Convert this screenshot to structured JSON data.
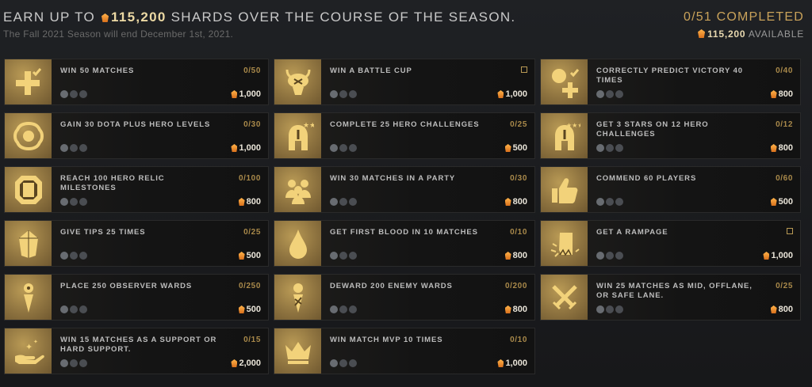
{
  "header": {
    "prefix": "EARN UP TO",
    "amount": "115,200",
    "suffix": "SHARDS OVER THE COURSE OF THE SEASON.",
    "sub": "The Fall 2021 Season will end December 1st, 2021.",
    "completed": "0/51 COMPLETED",
    "available_amount": "115,200",
    "available_label": "AVAILABLE"
  },
  "cards": [
    {
      "title": "WIN 50 MATCHES",
      "progress": "0/50",
      "reward": "1,000",
      "icon": "plus-check-icon"
    },
    {
      "title": "WIN A BATTLE CUP",
      "progress": "",
      "reward": "1,000",
      "icon": "battle-cup-icon"
    },
    {
      "title": "CORRECTLY PREDICT VICTORY 40 TIMES",
      "progress": "0/40",
      "reward": "800",
      "icon": "prediction-icon"
    },
    {
      "title": "GAIN 30 DOTA PLUS HERO LEVELS",
      "progress": "0/30",
      "reward": "1,000",
      "icon": "dota-plus-icon"
    },
    {
      "title": "COMPLETE 25 HERO CHALLENGES",
      "progress": "0/25",
      "reward": "500",
      "icon": "helmet-stars-icon"
    },
    {
      "title": "GET 3 STARS ON 12 HERO CHALLENGES",
      "progress": "0/12",
      "reward": "800",
      "icon": "helmet-three-stars-icon"
    },
    {
      "title": "REACH 100 HERO RELIC MILESTONES",
      "progress": "0/100",
      "reward": "800",
      "icon": "relic-icon"
    },
    {
      "title": "WIN 30 MATCHES IN A PARTY",
      "progress": "0/30",
      "reward": "800",
      "icon": "party-icon"
    },
    {
      "title": "COMMEND 60 PLAYERS",
      "progress": "0/60",
      "reward": "500",
      "icon": "thumbs-up-icon"
    },
    {
      "title": "GIVE TIPS 25 TIMES",
      "progress": "0/25",
      "reward": "500",
      "icon": "tip-gem-icon"
    },
    {
      "title": "GET FIRST BLOOD IN 10 MATCHES",
      "progress": "0/10",
      "reward": "800",
      "icon": "blood-drop-icon"
    },
    {
      "title": "GET A RAMPAGE",
      "progress": "",
      "reward": "1,000",
      "icon": "rampage-icon"
    },
    {
      "title": "PLACE 250 OBSERVER WARDS",
      "progress": "0/250",
      "reward": "500",
      "icon": "observer-ward-icon"
    },
    {
      "title": "DEWARD 200 ENEMY WARDS",
      "progress": "0/200",
      "reward": "800",
      "icon": "deward-icon"
    },
    {
      "title": "WIN 25 MATCHES AS MID, OFFLANE, OR SAFE LANE.",
      "progress": "0/25",
      "reward": "800",
      "icon": "crossed-swords-icon"
    },
    {
      "title": "WIN 15 MATCHES AS A SUPPORT OR HARD SUPPORT.",
      "progress": "0/15",
      "reward": "2,000",
      "icon": "support-hand-icon"
    },
    {
      "title": "WIN MATCH MVP 10 TIMES",
      "progress": "0/10",
      "reward": "1,000",
      "icon": "mvp-crown-icon"
    }
  ],
  "colors": {
    "gold": "#b99a55",
    "shard": "#e88a2a",
    "progress": "#a9894a"
  }
}
